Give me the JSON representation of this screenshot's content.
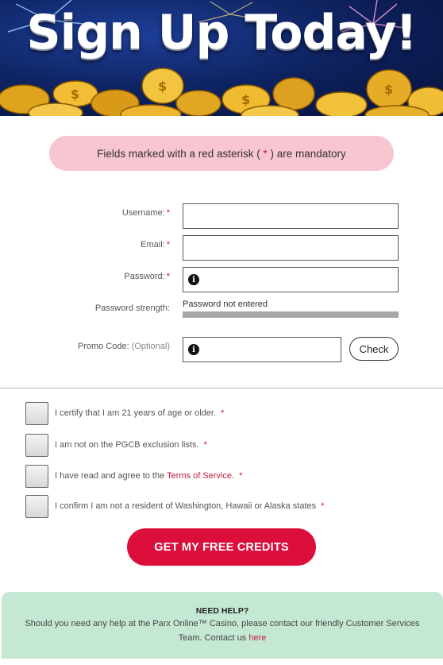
{
  "banner": {
    "title": "Sign Up Today!"
  },
  "notice": {
    "prefix": "Fields marked with a red asterisk ( ",
    "asterisk": "*",
    "suffix": " ) are mandatory"
  },
  "form": {
    "username": {
      "label": "Username:",
      "required": "*",
      "value": ""
    },
    "email": {
      "label": "Email:",
      "required": "*",
      "value": ""
    },
    "password": {
      "label": "Password:",
      "required": "*",
      "value": "",
      "info": "i"
    },
    "strength": {
      "label": "Password strength:",
      "status": "Password not entered"
    },
    "promo": {
      "label": "Promo Code:",
      "optional": "(Optional)",
      "value": "",
      "info": "i"
    },
    "check_label": "Check"
  },
  "checkboxes": [
    {
      "text": "I certify that I am 21 years of age or older.",
      "required": "*",
      "checked": false
    },
    {
      "text": "I am not on the PGCB exclusion lists.",
      "required": "*",
      "checked": false
    },
    {
      "text": "I have read and agree to the ",
      "link": "Terms of Service",
      "after": ".",
      "required": "*",
      "checked": false
    },
    {
      "text": "I confirm I am not a resident of Washington, Hawaii or Alaska states",
      "required": "*",
      "checked": false
    }
  ],
  "cta_label": "GET MY FREE CREDITS",
  "help": {
    "title": "NEED HELP?",
    "body": "Should you need any help at the Parx Online™ Casino, please contact our friendly Customer Services Team. Contact us ",
    "link": "here"
  },
  "colors": {
    "accent": "#dc0e3c",
    "notice_bg": "#f7c6d0",
    "help_bg": "#c4e8d3",
    "required": "#d0103a"
  }
}
